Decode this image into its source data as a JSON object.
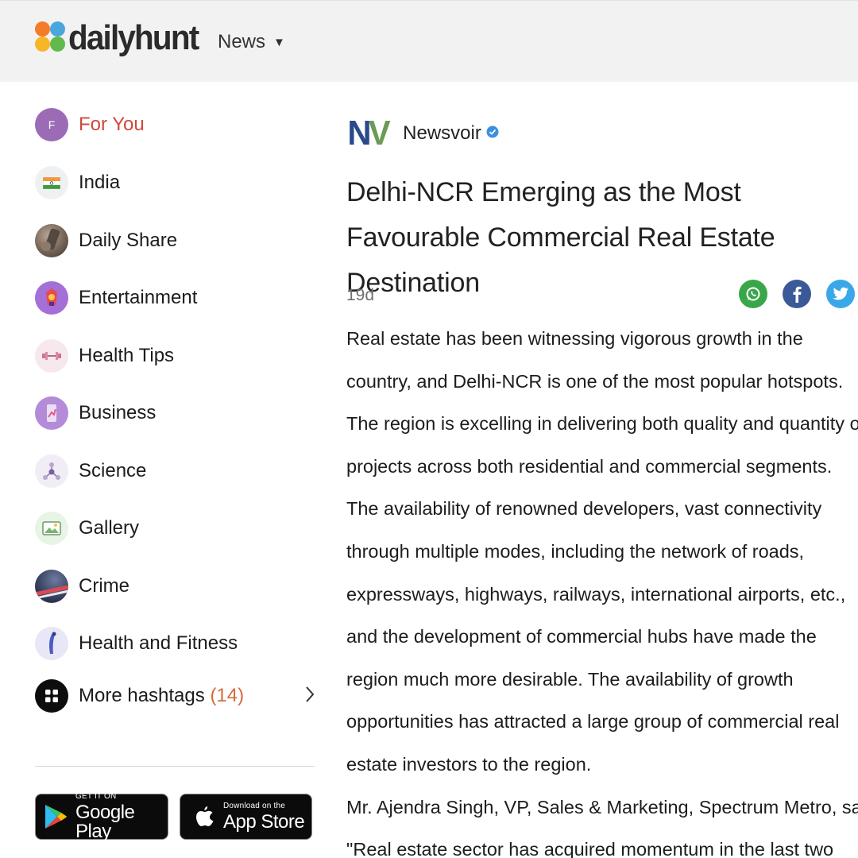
{
  "header": {
    "logo_text": "dailyhunt",
    "news_menu_label": "News",
    "caret_glyph": "▼",
    "colors": {
      "petal_1": "#f47b2a",
      "petal_2": "#4aa7d9",
      "petal_3": "#f6b626",
      "petal_4": "#62b94c"
    }
  },
  "sidebar": {
    "items": [
      {
        "label": "For You",
        "icon": "for-you-avatar",
        "avatar_letter": "F",
        "active": true
      },
      {
        "label": "India",
        "icon": "india-flag-icon"
      },
      {
        "label": "Daily Share",
        "icon": "daily-share-thumbnail"
      },
      {
        "label": "Entertainment",
        "icon": "entertainment-icon"
      },
      {
        "label": "Health Tips",
        "icon": "dumbbell-icon"
      },
      {
        "label": "Business",
        "icon": "business-icon"
      },
      {
        "label": "Science",
        "icon": "molecule-icon"
      },
      {
        "label": "Gallery",
        "icon": "picture-icon"
      },
      {
        "label": "Crime",
        "icon": "crime-thumbnail"
      },
      {
        "label": "Health and Fitness",
        "icon": "fitness-icon"
      }
    ],
    "more": {
      "label": "More hashtags",
      "count": "(14)",
      "icon": "grid-icon",
      "chevron": "chevron-right-icon"
    },
    "stores": {
      "google": {
        "small": "GET IT ON",
        "big": "Google Play"
      },
      "apple": {
        "small": "Download on the",
        "big": "App Store"
      }
    }
  },
  "article": {
    "publisher": {
      "logo_text_1": "N",
      "logo_text_2": "V",
      "name": "Newsvoir",
      "verified": true
    },
    "headline": "Delhi-NCR Emerging as the Most Favourable Commercial Real Estate Destination",
    "age": "19d",
    "share": [
      "whatsapp-icon",
      "facebook-icon",
      "twitter-icon"
    ],
    "body_lines": [
      "Real estate has been witnessing vigorous growth in the",
      "country, and Delhi-NCR is one of the most popular hotspots.",
      "The region is excelling in delivering both quality and quantity of",
      "projects across both residential and commercial segments.",
      "The availability of renowned developers, vast connectivity",
      "through multiple modes, including the network of roads,",
      "expressways, highways, railways, international airports, etc.,",
      "and the development of commercial hubs have made the",
      "region much more desirable. The availability of growth",
      "opportunities has attracted a large group of commercial real",
      "estate investors to the region.",
      "Mr. Ajendra Singh, VP, Sales & Marketing, Spectrum Metro, said,",
      "\"Real estate sector has acquired momentum in the last two"
    ]
  }
}
